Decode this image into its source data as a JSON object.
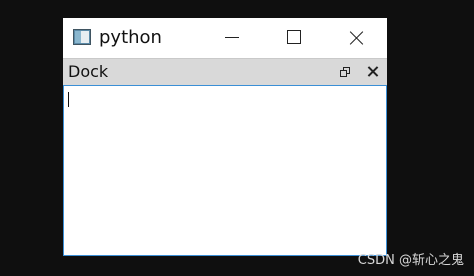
{
  "window": {
    "title": "python",
    "icon": "python-app-icon",
    "controls": {
      "minimize_icon": "minimize-icon",
      "maximize_icon": "maximize-icon",
      "close_icon": "close-icon"
    }
  },
  "dock": {
    "title": "Dock",
    "float_icon": "float-icon",
    "close_icon": "dock-close-icon"
  },
  "editor": {
    "value": ""
  },
  "watermark": {
    "text": "CSDN @斩心之鬼"
  },
  "colors": {
    "background": "#0f0f0f",
    "titlebar": "#ffffff",
    "dockbar": "#d9d9d9",
    "focus_border": "#3b8fd6"
  }
}
